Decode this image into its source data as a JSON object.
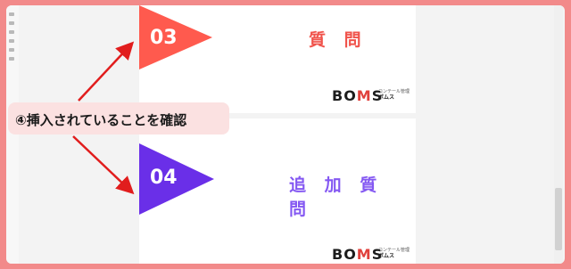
{
  "slides": [
    {
      "number": "03",
      "title": "質 問",
      "title_color": "#f0534b",
      "triangle_color": "#ff5a4e"
    },
    {
      "number": "04",
      "title": "追 加 質 問",
      "title_color": "#8458f2",
      "triangle_color": "#6a2fe8"
    }
  ],
  "logo": {
    "main_pre": "BO",
    "main_accent": "M",
    "main_post": "S",
    "sub_line1": "コンテール管理",
    "sub_line2": "ボムス"
  },
  "callout": {
    "text": "④挿入されていることを確認"
  },
  "colors": {
    "frame": "#f28a8a",
    "arrow": "#e11d1d",
    "callout_bg": "#fbe1e1"
  }
}
